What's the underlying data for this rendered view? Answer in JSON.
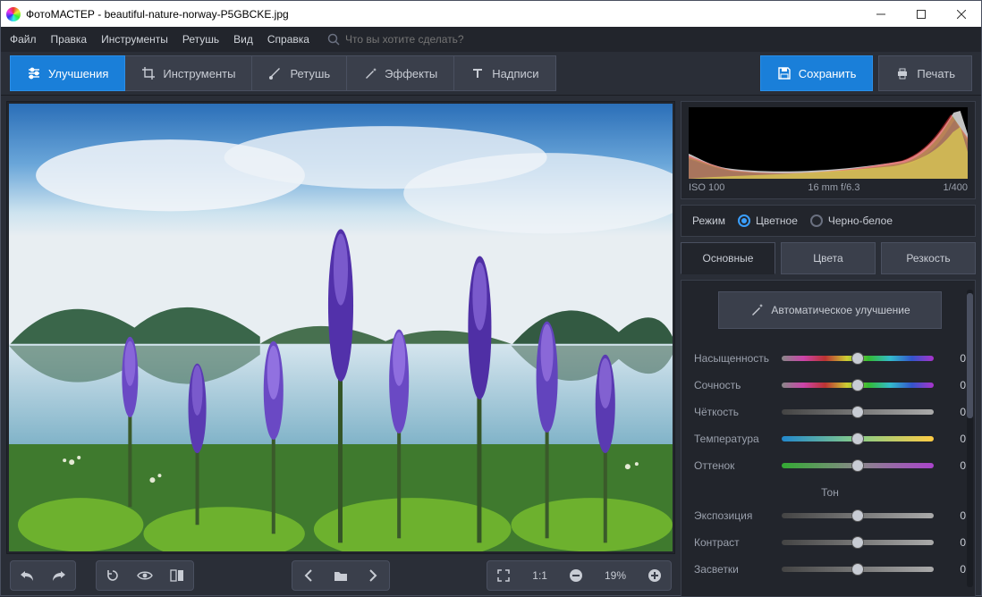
{
  "window": {
    "title": "ФотоМАСТЕР - beautiful-nature-norway-P5GBCKE.jpg"
  },
  "menu": {
    "file": "Файл",
    "edit": "Правка",
    "tools": "Инструменты",
    "retouch": "Ретушь",
    "view": "Вид",
    "help": "Справка",
    "search_placeholder": "Что вы хотите сделать?"
  },
  "tabs": {
    "enhance": "Улучшения",
    "tools": "Инструменты",
    "retouch": "Ретушь",
    "effects": "Эффекты",
    "text": "Надписи"
  },
  "actions": {
    "save": "Сохранить",
    "print": "Печать"
  },
  "canvas": {
    "zoom_ratio": "1:1",
    "zoom_percent": "19%"
  },
  "histogram_meta": {
    "iso": "ISO 100",
    "lens": "16 mm f/6.3",
    "shutter": "1/400"
  },
  "mode": {
    "label": "Режим",
    "color": "Цветное",
    "bw": "Черно-белое"
  },
  "subtabs": {
    "basic": "Основные",
    "colors": "Цвета",
    "sharpen": "Резкость"
  },
  "auto_enhance": "Автоматическое улучшение",
  "sliders": {
    "saturation": {
      "label": "Насыщенность",
      "value": "0"
    },
    "vibrance": {
      "label": "Сочность",
      "value": "0"
    },
    "clarity": {
      "label": "Чёткость",
      "value": "0"
    },
    "temperature": {
      "label": "Температура",
      "value": "0"
    },
    "tint": {
      "label": "Оттенок",
      "value": "0"
    },
    "tone_title": "Тон",
    "exposure": {
      "label": "Экспозиция",
      "value": "0"
    },
    "contrast": {
      "label": "Контраст",
      "value": "0"
    },
    "highlights": {
      "label": "Засветки",
      "value": "0"
    }
  }
}
